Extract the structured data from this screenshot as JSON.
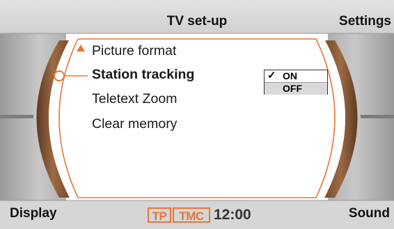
{
  "header": {
    "title": "TV set-up",
    "right_label": "Settings"
  },
  "menu": {
    "items": [
      {
        "label": "Picture format"
      },
      {
        "label": "Station tracking"
      },
      {
        "label": "Teletext Zoom"
      },
      {
        "label": "Clear memory"
      }
    ],
    "selected_index": 1
  },
  "options": {
    "on_label": "ON",
    "off_label": "OFF",
    "checked": "ON",
    "check_icon": "check-icon"
  },
  "footer": {
    "left_label": "Display",
    "right_label": "Sound",
    "tp_label": "TP",
    "tmc_label": "TMC",
    "clock": "12:00"
  },
  "colors": {
    "accent": "#e8743a",
    "bezel_brown": "#8a5a3a",
    "panel_grey": "#bfbfbf"
  }
}
